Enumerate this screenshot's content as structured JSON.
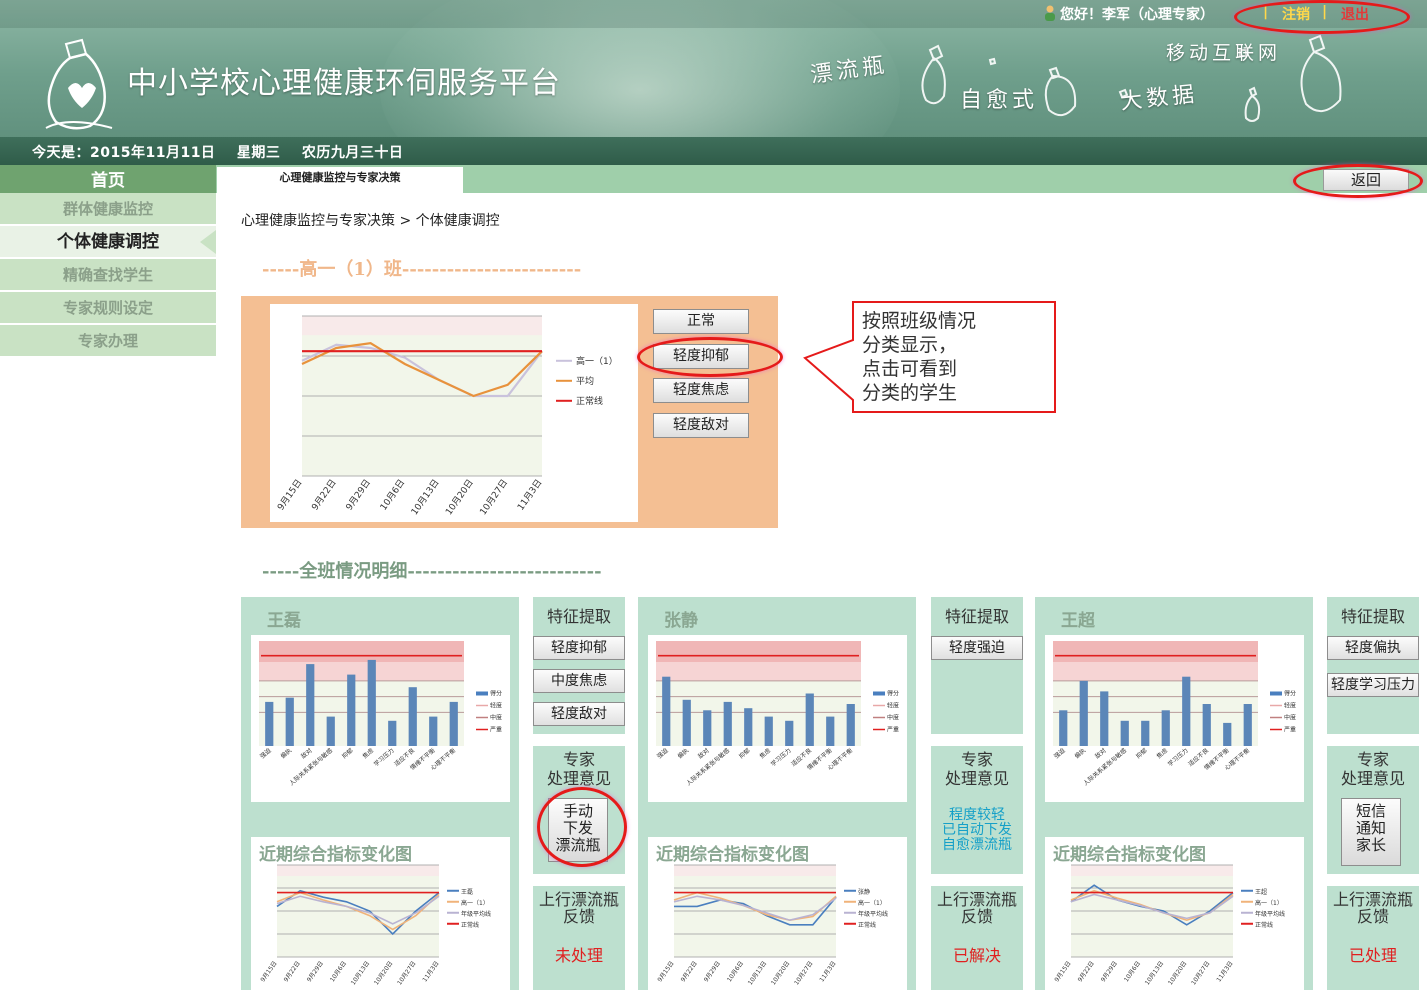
{
  "header": {
    "site_title": "中小学校心理健康环伺服务平台",
    "greeting": "您好！李军（心理专家）",
    "logout_label": "注销",
    "exit_label": "退出",
    "separator": "|",
    "today": "今天是：2015年11月11日    星期三    农历九月三十日",
    "deco_words": [
      "漂流瓶",
      "自愈式",
      "大数据",
      "移动互联网"
    ]
  },
  "nav": {
    "home_label": "首页",
    "active_tab": "心理健康监控与专家决策",
    "back_label": "返回"
  },
  "sidebar": {
    "items": [
      {
        "label": "群体健康监控"
      },
      {
        "label": "个体健康调控"
      },
      {
        "label": "精确查找学生"
      },
      {
        "label": "专家规则设定"
      },
      {
        "label": "专家办理"
      }
    ]
  },
  "breadcrumb": "心理健康监控与专家决策 > 个体健康调控",
  "class_section": {
    "title": "-----高一（1）班------------------------",
    "categories": [
      "正常",
      "轻度抑郁",
      "轻度焦虑",
      "轻度敌对"
    ],
    "callout": "按照班级情况\n 分类显示，\n 点击可看到\n 分类的学生"
  },
  "detail_section": {
    "title": "-----全班情况明细--------------------------"
  },
  "chart_data": [
    {
      "type": "line",
      "x": [
        "9月15日",
        "9月22日",
        "9月29日",
        "10月6日",
        "10月13日",
        "10月20日",
        "10月27日",
        "11月3日"
      ],
      "series": [
        {
          "name": "高一（1）",
          "values": [
            0.72,
            0.82,
            0.8,
            0.74,
            0.6,
            0.5,
            0.5,
            0.78
          ],
          "color": "#c9c2dc"
        },
        {
          "name": "平均",
          "values": [
            0.7,
            0.8,
            0.83,
            0.7,
            0.6,
            0.5,
            0.57,
            0.78
          ],
          "color": "#e8923c"
        },
        {
          "name": "正常线",
          "values": [
            0.78,
            0.78,
            0.78,
            0.78,
            0.78,
            0.78,
            0.78,
            0.78
          ],
          "color": "#e02020"
        }
      ],
      "ylim": [
        0,
        1
      ]
    },
    {
      "type": "bar",
      "categories": [
        "强迫",
        "偏执",
        "敌对",
        "人际关系紧张与敏感",
        "抑郁",
        "焦虑",
        "学习压力",
        "适应不良",
        "情绪不平衡",
        "心理不平衡"
      ],
      "series": [
        {
          "name": "得分",
          "values": [
            2.1,
            2.3,
            3.9,
            1.4,
            3.4,
            4.1,
            1.2,
            2.8,
            1.4,
            2.1
          ]
        }
      ],
      "legend": [
        "得分",
        "轻度",
        "中度",
        "严重"
      ],
      "ylim": [
        0,
        5
      ]
    },
    {
      "type": "bar",
      "categories": [
        "强迫",
        "偏执",
        "敌对",
        "人际关系紧张与敏感",
        "抑郁",
        "焦虑",
        "学习压力",
        "适应不良",
        "情绪不平衡",
        "心理不平衡"
      ],
      "series": [
        {
          "name": "得分",
          "values": [
            3.3,
            2.2,
            1.7,
            2.1,
            1.8,
            1.4,
            1.2,
            2.5,
            1.4,
            2.0
          ]
        }
      ],
      "legend": [
        "得分",
        "轻度",
        "中度",
        "严重"
      ],
      "ylim": [
        0,
        5
      ]
    },
    {
      "type": "bar",
      "categories": [
        "强迫",
        "偏执",
        "敌对",
        "人际关系紧张与敏感",
        "抑郁",
        "焦虑",
        "学习压力",
        "适应不良",
        "情绪不平衡",
        "心理不平衡"
      ],
      "series": [
        {
          "name": "得分",
          "values": [
            1.7,
            3.1,
            2.6,
            1.2,
            1.2,
            1.7,
            3.3,
            2.0,
            1.1,
            2.0
          ]
        }
      ],
      "legend": [
        "得分",
        "轻度",
        "中度",
        "严重"
      ],
      "ylim": [
        0,
        5
      ]
    },
    {
      "type": "line",
      "x": [
        "9月15日",
        "9月22日",
        "9月29日",
        "10月6日",
        "10月13日",
        "10月20日",
        "10月27日",
        "11月3日"
      ],
      "series": [
        {
          "name": "王磊",
          "values": [
            0.55,
            0.72,
            0.65,
            0.6,
            0.5,
            0.25,
            0.5,
            0.7
          ],
          "color": "#4a7fbf"
        },
        {
          "name": "高一（1）",
          "values": [
            0.6,
            0.7,
            0.62,
            0.55,
            0.45,
            0.3,
            0.45,
            0.68
          ],
          "color": "#f0b37a"
        },
        {
          "name": "年级平均线",
          "values": [
            0.58,
            0.66,
            0.6,
            0.55,
            0.48,
            0.36,
            0.48,
            0.66
          ],
          "color": "#b9b3d2"
        },
        {
          "name": "正常线",
          "values": [
            0.7,
            0.7,
            0.7,
            0.7,
            0.7,
            0.7,
            0.7,
            0.7
          ],
          "color": "#e02020"
        }
      ],
      "ylim": [
        0,
        1
      ]
    },
    {
      "type": "line",
      "x": [
        "9月15日",
        "9月22日",
        "9月29日",
        "10月6日",
        "10月13日",
        "10月20日",
        "10月27日",
        "11月3日"
      ],
      "series": [
        {
          "name": "张静",
          "values": [
            0.55,
            0.55,
            0.62,
            0.58,
            0.45,
            0.35,
            0.35,
            0.65
          ],
          "color": "#4a7fbf"
        },
        {
          "name": "高一（1）",
          "values": [
            0.62,
            0.7,
            0.64,
            0.56,
            0.46,
            0.4,
            0.44,
            0.66
          ],
          "color": "#f0b37a"
        },
        {
          "name": "年级平均线",
          "values": [
            0.6,
            0.66,
            0.62,
            0.56,
            0.48,
            0.4,
            0.46,
            0.64
          ],
          "color": "#b9b3d2"
        },
        {
          "name": "正常线",
          "values": [
            0.7,
            0.7,
            0.7,
            0.7,
            0.7,
            0.7,
            0.7,
            0.7
          ],
          "color": "#e02020"
        }
      ],
      "ylim": [
        0,
        1
      ]
    },
    {
      "type": "line",
      "x": [
        "9月15日",
        "9月22日",
        "9月29日",
        "10月6日",
        "10月13日",
        "10月20日",
        "10月27日",
        "11月3日"
      ],
      "series": [
        {
          "name": "王超",
          "values": [
            0.6,
            0.78,
            0.62,
            0.55,
            0.5,
            0.35,
            0.5,
            0.7
          ],
          "color": "#4a7fbf"
        },
        {
          "name": "高一（1）",
          "values": [
            0.62,
            0.72,
            0.64,
            0.57,
            0.48,
            0.4,
            0.48,
            0.68
          ],
          "color": "#f0b37a"
        },
        {
          "name": "年级平均线",
          "values": [
            0.6,
            0.68,
            0.62,
            0.56,
            0.48,
            0.42,
            0.48,
            0.66
          ],
          "color": "#b9b3d2"
        },
        {
          "name": "正常线",
          "values": [
            0.7,
            0.7,
            0.7,
            0.7,
            0.7,
            0.7,
            0.7,
            0.7
          ],
          "color": "#e02020"
        }
      ],
      "ylim": [
        0,
        1
      ]
    }
  ],
  "students": [
    {
      "name": "王磊",
      "trend_title": "近期综合指标变化图",
      "feature_title": "特征提取",
      "features": [
        "轻度抑郁",
        "中度焦虑",
        "轻度敌对"
      ],
      "opinion_title": "专家\n处理意见",
      "opinion_button": "手动\n下发\n漂流瓶",
      "feedback_title": "上行漂流瓶\n反馈",
      "feedback_status": "未处理"
    },
    {
      "name": "张静",
      "trend_title": "近期综合指标变化图",
      "feature_title": "特征提取",
      "features": [
        "轻度强迫"
      ],
      "opinion_title": "专家\n处理意见",
      "opinion_note": "程度较轻\n已自动下发\n自愈漂流瓶",
      "feedback_title": "上行漂流瓶\n反馈",
      "feedback_status": "已解决"
    },
    {
      "name": "王超",
      "trend_title": "近期综合指标变化图",
      "feature_title": "特征提取",
      "features": [
        "轻度偏执",
        "轻度学习压力"
      ],
      "opinion_title": "专家\n处理意见",
      "opinion_button": "短信\n通知\n家长",
      "feedback_title": "上行漂流瓶\n反馈",
      "feedback_status": "已处理"
    }
  ],
  "colors": {
    "accent_orange": "#f4bf93",
    "card_green": "#bde0cf",
    "nav_green": "#9fcfaa",
    "alert_red": "#e51a1a",
    "note_blue": "#16a0c8"
  }
}
